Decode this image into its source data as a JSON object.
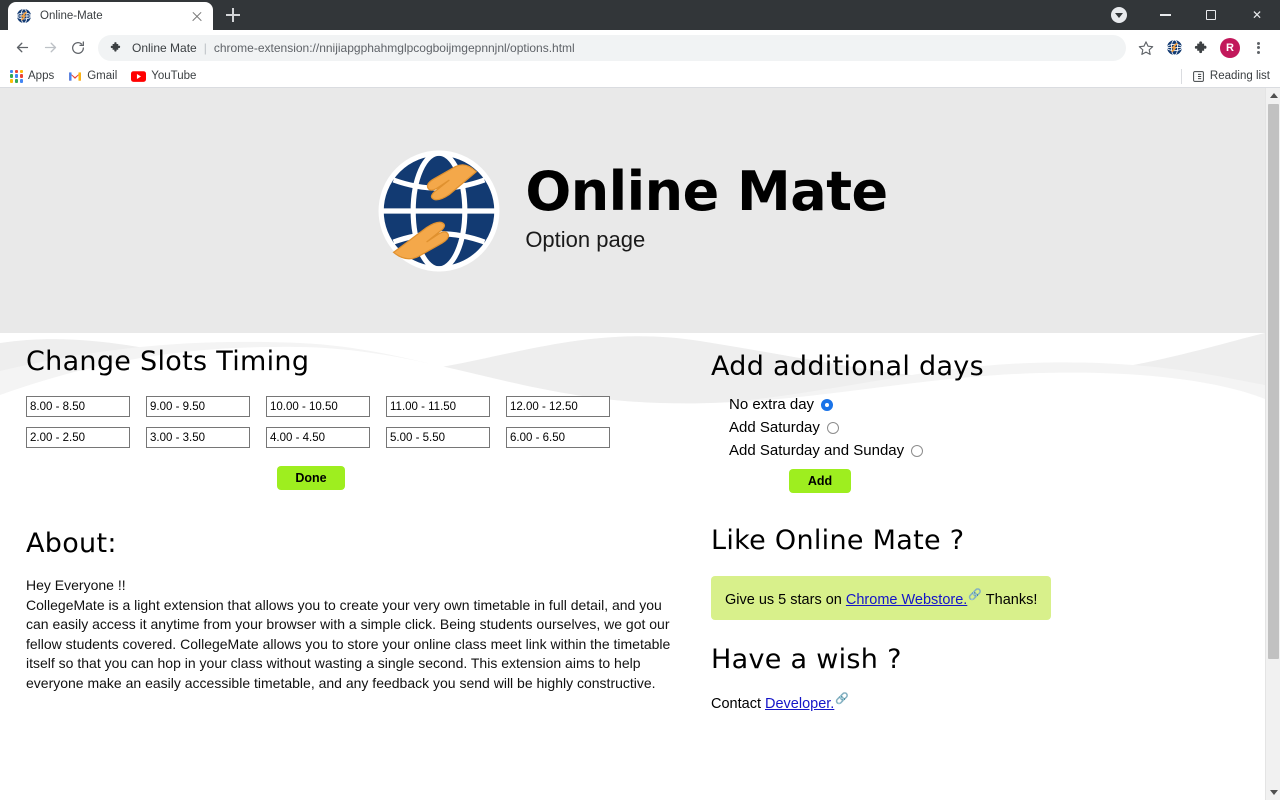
{
  "browser": {
    "tab": {
      "title": "Online-Mate",
      "favicon": "globe-icon",
      "close": "close-icon"
    },
    "new_tab_label": "+",
    "window_controls": {
      "download": "download-icon",
      "minimize": "minimize-icon",
      "maximize": "maximize-icon",
      "close": "close-icon"
    },
    "nav": {
      "back": "back-arrow-icon",
      "forward": "forward-arrow-icon",
      "reload": "reload-icon"
    },
    "omnibox": {
      "extension_icon": "extension-puzzle-icon",
      "extension_name": "Online Mate",
      "separator": "|",
      "url": "chrome-extension://nnijiapgphahmglpcogboijmgepnnjnl/options.html",
      "star": "bookmark-star-icon"
    },
    "toolbar_icons": {
      "globe_ext": "globe-extension-icon",
      "puzzle": "extensions-puzzle-icon",
      "profile_initial": "R",
      "menu": "three-dot-menu-icon"
    },
    "bookmarks": [
      {
        "label": "Apps",
        "icon": "apps-grid-icon"
      },
      {
        "label": "Gmail",
        "icon": "gmail-icon"
      },
      {
        "label": "YouTube",
        "icon": "youtube-icon"
      }
    ],
    "reading_list": {
      "label": "Reading list",
      "icon": "reading-list-icon"
    }
  },
  "colors": {
    "hero_bg": "#e9e9e9",
    "button_green": "#9eee1f",
    "highlight_green": "#d8f08b",
    "link_blue": "#1414c8",
    "radio_selected": "#1a73e8",
    "logo_navy": "#123a72",
    "logo_orange": "#f0a043",
    "profile_pink": "#c2185b"
  },
  "hero": {
    "logo_name": "online-mate-globe-handshake-logo",
    "title": "Online Mate",
    "subtitle": "Option page"
  },
  "slots": {
    "heading": "Change Slots Timing",
    "values": [
      "8.00 - 8.50",
      "9.00 - 9.50",
      "10.00 - 10.50",
      "11.00 - 11.50",
      "12.00 - 12.50",
      "2.00 - 2.50",
      "3.00 - 3.50",
      "4.00 - 4.50",
      "5.00 - 5.50",
      "6.00 - 6.50"
    ],
    "done_label": "Done"
  },
  "extra_days": {
    "heading": "Add additional days",
    "options": [
      {
        "label": "No extra day",
        "selected": true
      },
      {
        "label": "Add Saturday",
        "selected": false
      },
      {
        "label": "Add Saturday and Sunday",
        "selected": false
      }
    ],
    "add_label": "Add"
  },
  "about": {
    "heading": "About:",
    "greeting": "Hey Everyone !!",
    "body": "CollegeMate is a light extension that allows you to create your very own timetable in full detail, and you can easily access it anytime from your browser with a simple click. Being students ourselves, we got our fellow students covered. CollegeMate allows you to store your online class meet link within the timetable itself so that you can hop in your class without wasting a single second. This extension aims to help everyone make an easily accessible timetable, and any feedback you send will be highly constructive."
  },
  "rate": {
    "heading": "Like Online Mate ?",
    "text_before": "Give us 5 stars on ",
    "link_label": "Chrome Webstore.",
    "link_icon": "external-link-icon",
    "text_after": " Thanks!"
  },
  "wish": {
    "heading": "Have a wish ?",
    "text_before": "Contact ",
    "link_label": "Developer.",
    "link_icon": "external-link-icon"
  }
}
